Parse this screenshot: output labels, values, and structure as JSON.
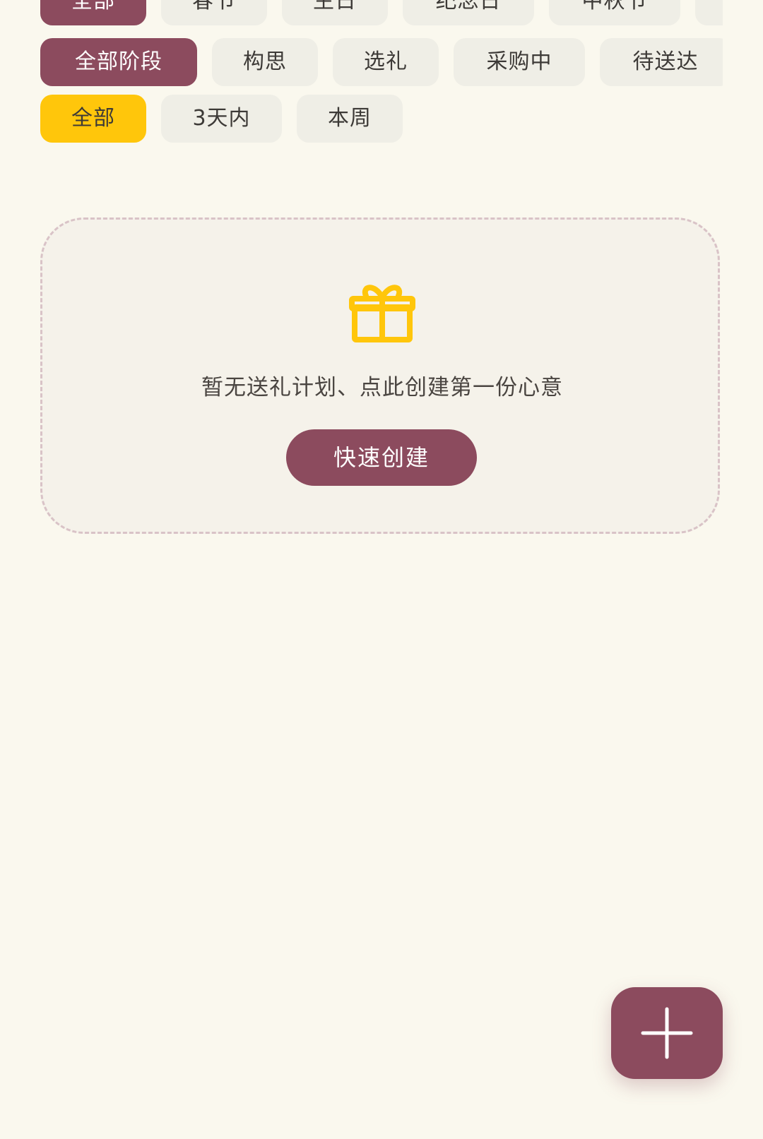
{
  "filters": {
    "occasion": [
      {
        "label": "全部",
        "active": true
      },
      {
        "label": "春节",
        "active": false
      },
      {
        "label": "生日",
        "active": false
      },
      {
        "label": "纪念日",
        "active": false
      },
      {
        "label": "中秋节",
        "active": false
      },
      {
        "label": "",
        "active": false
      }
    ],
    "stage": [
      {
        "label": "全部阶段",
        "active": true
      },
      {
        "label": "构思",
        "active": false
      },
      {
        "label": "选礼",
        "active": false
      },
      {
        "label": "采购中",
        "active": false
      },
      {
        "label": "待送达",
        "active": false
      }
    ],
    "time": [
      {
        "label": "全部",
        "active": true
      },
      {
        "label": "3天内",
        "active": false
      },
      {
        "label": "本周",
        "active": false
      }
    ]
  },
  "empty_state": {
    "icon": "gift-icon",
    "message": "暂无送礼计划、点此创建第一份心意",
    "button_label": "快速创建"
  },
  "fab": {
    "icon": "plus-icon"
  },
  "colors": {
    "background": "#FAF8EE",
    "accent_maroon": "#8C4B5E",
    "accent_yellow": "#FFC60B",
    "chip_inactive": "#EFEEE6",
    "card_border": "#D9C3C7"
  }
}
